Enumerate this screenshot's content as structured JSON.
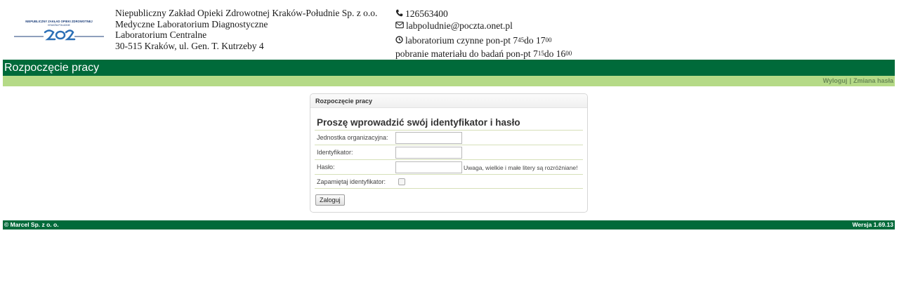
{
  "logo": {
    "line1": "NIEPUBLICZNY ZAKŁAD OPIEKI ZDROWOTNEJ",
    "line2": "KRAKÓW-POŁUDNIE",
    "mark": "ZOZ"
  },
  "org": {
    "line1": "Niepubliczny Zakład Opieki Zdrowotnej Kraków-Południe Sp. z o.o.",
    "line2": "Medyczne Laboratorium Diagnostyczne",
    "line3": "Laboratorium Centralne",
    "line4": "30-515 Kraków, ul. Gen. T. Kutrzeby 4"
  },
  "contact": {
    "phone": "126563400",
    "email": "labpoludnie@poczta.onet.pl",
    "hours_text": "laboratorium czynne pon-pt 7",
    "hours_from_sup": "45",
    "hours_to": " do 17",
    "hours_to_sup": "00",
    "collection_text": "pobranie materiału do badań pon-pt 7",
    "collection_from_sup": "15",
    "collection_to": " do 16",
    "collection_to_sup": "00"
  },
  "title_bar": "Rozpoczęcie pracy",
  "top_links": {
    "logout": "Wyloguj",
    "separator": "|",
    "change_password": "Zmiana hasła"
  },
  "panel": {
    "title": "Rozpoczęcie pracy",
    "heading": "Proszę wprowadzić swój identyfikator i hasło",
    "fields": {
      "unit_label": "Jednostka organizacyjna:",
      "unit_value": "",
      "id_label": "Identyfikator:",
      "id_value": "",
      "password_label": "Hasło:",
      "password_value": "",
      "password_note": "Uwaga, wielkie i małe litery są rozróżniane!",
      "remember_label": "Zapamiętaj identyfikator:",
      "remember_checked": false
    },
    "submit_label": "Zaloguj"
  },
  "footer": {
    "copyright": "© Marcel Sp. z o. o.",
    "version": "Wersja 1.69.13"
  },
  "colors": {
    "primary_green": "#006a3a",
    "light_green": "#b5da87",
    "logo_blue": "#1d3f7a"
  }
}
